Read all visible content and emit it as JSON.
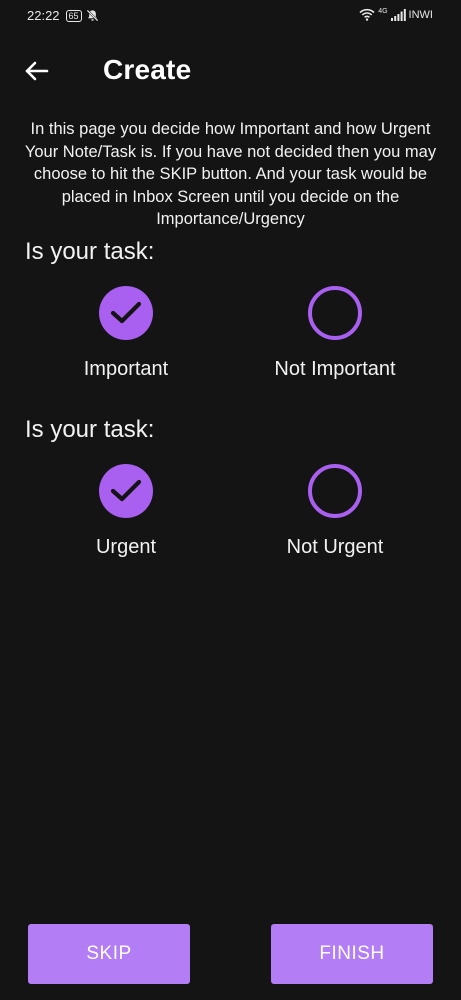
{
  "status_bar": {
    "time": "22:22",
    "battery": "65",
    "network_type": "4G",
    "carrier": "INWI"
  },
  "header": {
    "title": "Create"
  },
  "description": "In this page you decide how Important and how Urgent Your Note/Task is. If you have not decided then you may choose to hit the SKIP button. And your task would be placed in Inbox Screen until you decide on the Importance/Urgency",
  "importance": {
    "label": "Is your task:",
    "options": [
      {
        "label": "Important",
        "selected": true
      },
      {
        "label": "Not Important",
        "selected": false
      }
    ]
  },
  "urgency": {
    "label": "Is your task:",
    "options": [
      {
        "label": "Urgent",
        "selected": true
      },
      {
        "label": "Not Urgent",
        "selected": false
      }
    ]
  },
  "buttons": {
    "skip": "SKIP",
    "finish": "FINISH"
  },
  "colors": {
    "accent": "#a95ff0",
    "button": "#b27df5",
    "background": "#141414"
  },
  "icons": {
    "back": "arrow-left-icon",
    "check": "checkmark-icon",
    "mute": "bell-off-icon",
    "wifi": "wifi-icon",
    "signal": "signal-bars-icon"
  }
}
